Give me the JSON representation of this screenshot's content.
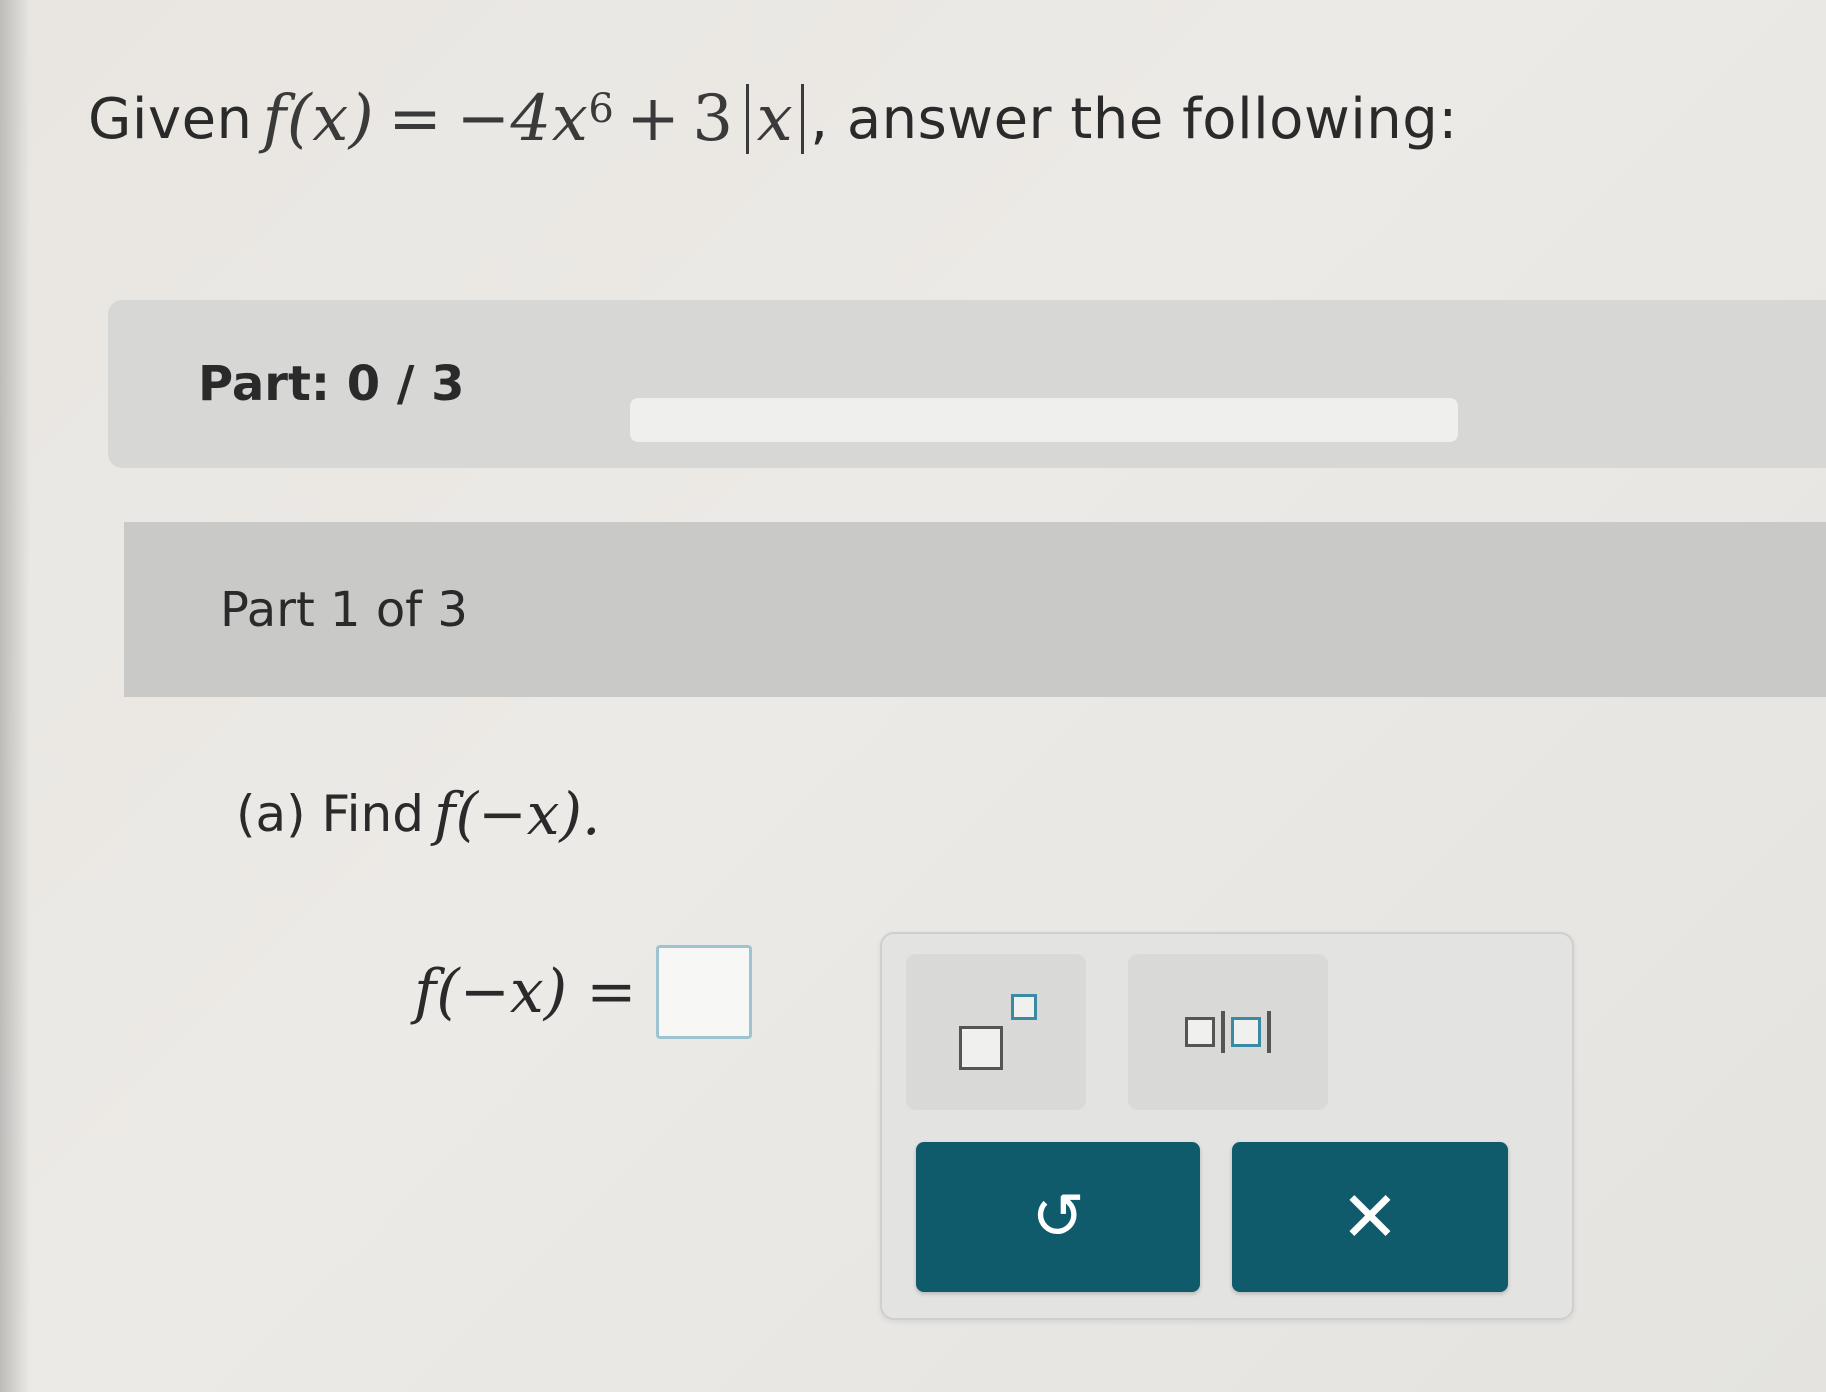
{
  "problem": {
    "lead": "Given",
    "f_of_x": "f(x)",
    "equals": "=",
    "term1": "−4x",
    "exponent": "6",
    "plus": "+",
    "coef": "3",
    "abs_var": "x",
    "tail": ", answer the following:"
  },
  "progress": {
    "label": "Part: 0 / 3",
    "completed": 0,
    "total": 3
  },
  "step": {
    "label": "Part 1 of 3"
  },
  "question": {
    "prefix": "(a) Find",
    "expr": "f(−x)."
  },
  "answer": {
    "lhs": "f(−x) ="
  },
  "keypad": {
    "exponent_key": "exponent-template",
    "abs_key": "absolute-value-template",
    "undo_icon": "undo-icon",
    "clear_icon": "clear-icon",
    "undo_glyph": "↺",
    "clear_glyph": "✕"
  },
  "colors": {
    "action_button": "#0f5a6b",
    "input_border": "#9ec3d1",
    "progress_fill": "#1d6f8a"
  }
}
